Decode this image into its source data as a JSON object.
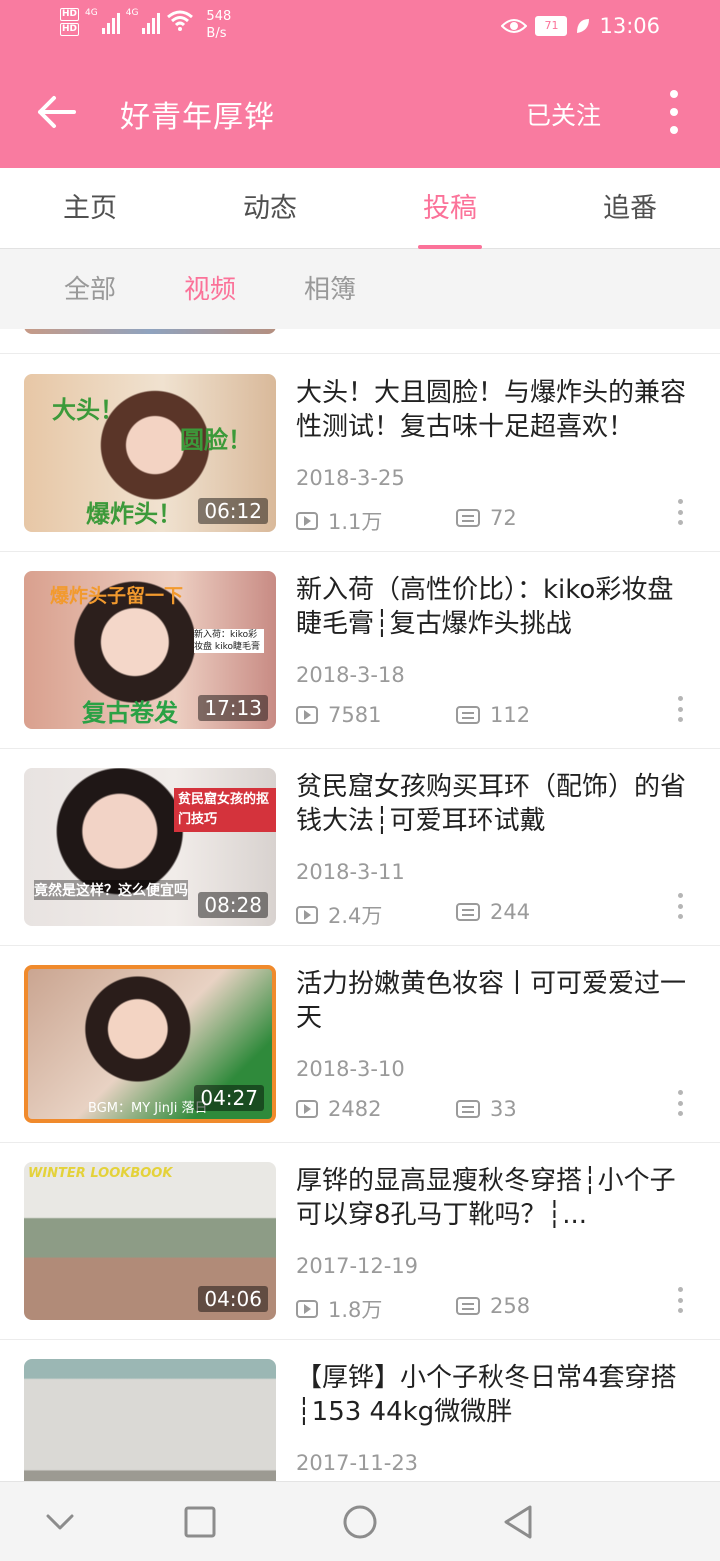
{
  "status_bar": {
    "network_1": "4G",
    "network_2": "4G",
    "speed_value": "548",
    "speed_unit": "B/s",
    "battery": "71",
    "time": "13:06"
  },
  "header": {
    "title": "好青年厚铧",
    "follow_label": "已关注"
  },
  "tabs": [
    "主页",
    "动态",
    "投稿",
    "追番"
  ],
  "active_tab": "投稿",
  "subtabs": [
    "全部",
    "视频",
    "相簿"
  ],
  "active_subtab": "视频",
  "videos": [
    {
      "title": "大头！大且圆脸！与爆炸头的兼容性测试！复古味十足超喜欢！",
      "date": "2018-3-25",
      "views": "1.1万",
      "danmaku": "72",
      "duration": "06:12",
      "thumb_captions": [
        "大头！",
        "圆脸！",
        "爆炸头！"
      ]
    },
    {
      "title": "新入荷（高性价比）：kiko彩妆盘睫毛膏┆复古爆炸头挑战",
      "date": "2018-3-18",
      "views": "7581",
      "danmaku": "112",
      "duration": "17:13",
      "thumb_captions": [
        "爆炸头子留一下",
        "复古卷发",
        "新入荷：kiko彩妆盘 kiko睫毛膏"
      ]
    },
    {
      "title": "贫民窟女孩购买耳环（配饰）的省钱大法┆可爱耳环试戴",
      "date": "2018-3-11",
      "views": "2.4万",
      "danmaku": "244",
      "duration": "08:28",
      "thumb_captions": [
        "贫民窟女孩的抠门技巧",
        "竟然是这样？这么便宜吗"
      ]
    },
    {
      "title": "活力扮嫩黄色妆容丨可可爱爱过一天",
      "date": "2018-3-10",
      "views": "2482",
      "danmaku": "33",
      "duration": "04:27",
      "thumb_captions": [
        "BGM：MY JinJi 落日"
      ]
    },
    {
      "title": "厚铧的显高显瘦秋冬穿搭┆小个子可以穿8孔马丁靴吗？┆...",
      "date": "2017-12-19",
      "views": "1.8万",
      "danmaku": "258",
      "duration": "04:06",
      "thumb_captions": [
        "WINTER LOOKBOOK"
      ]
    },
    {
      "title": "【厚铧】小个子秋冬日常4套穿搭┆153 44kg微微胖",
      "date": "2017-11-23",
      "views": "",
      "danmaku": "",
      "duration": "",
      "thumb_captions": []
    }
  ],
  "icons": {
    "back": "arrow-left-icon",
    "more": "vertical-dots-icon",
    "views": "play-count-icon",
    "danmaku": "danmaku-icon",
    "nav_back": "triangle-back-icon",
    "nav_home": "circle-home-icon",
    "nav_recent": "square-recents-icon",
    "nav_down": "chevron-down-icon"
  },
  "colors": {
    "accent": "#fb7299",
    "header": "#f97ba0",
    "muted_text": "#9a9a9a"
  }
}
